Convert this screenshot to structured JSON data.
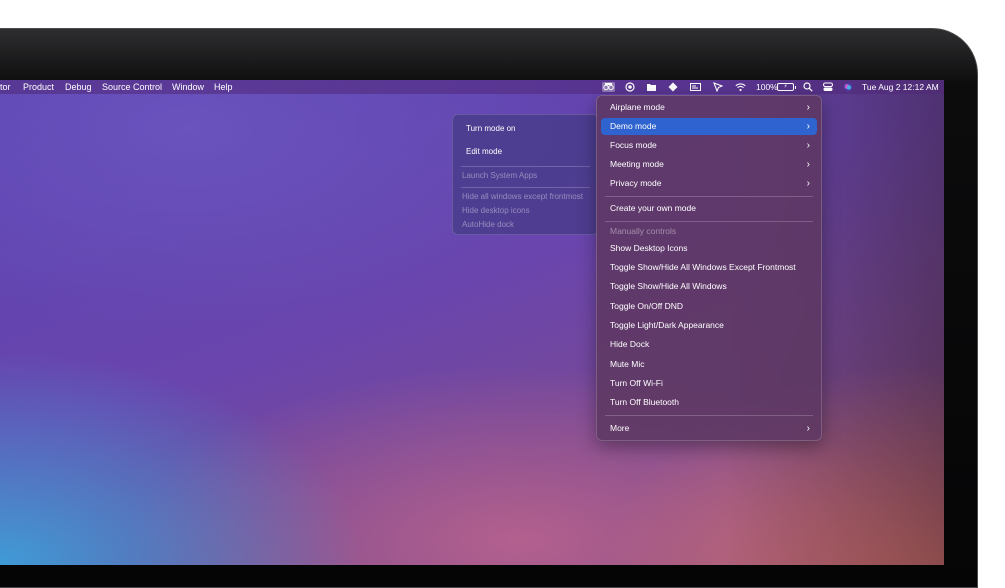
{
  "menubar": {
    "items": [
      "tor",
      "Product",
      "Debug",
      "Source Control",
      "Window",
      "Help"
    ],
    "battery_percent": "100%",
    "battery_icon_text": "⚡",
    "clock": "Tue Aug 2  12:12 AM",
    "status_icons": [
      "app-menu-icon",
      "focus-icon",
      "folder-icon",
      "diamond-icon",
      "card-icon",
      "cursor-icon",
      "wifi-icon",
      "battery-icon",
      "spotlight-icon",
      "control-center-icon",
      "siri-icon"
    ]
  },
  "main_menu": {
    "items": [
      {
        "label": "Airplane mode",
        "submenu": true
      },
      {
        "label": "Demo mode",
        "submenu": true,
        "selected": true
      },
      {
        "label": "Focus mode",
        "submenu": true
      },
      {
        "label": "Meeting mode",
        "submenu": true
      },
      {
        "label": "Privacy mode",
        "submenu": true
      },
      {
        "label": "Create your own mode"
      },
      {
        "label": "Manually controls",
        "disabled": true
      },
      {
        "label": "Show Desktop Icons"
      },
      {
        "label": "Toggle Show/Hide All Windows Except Frontmost"
      },
      {
        "label": "Toggle Show/Hide All Windows"
      },
      {
        "label": "Toggle On/Off DND"
      },
      {
        "label": "Toggle Light/Dark Appearance"
      },
      {
        "label": "Hide Dock"
      },
      {
        "label": "Mute Mic"
      },
      {
        "label": "Turn Off Wi-Fi"
      },
      {
        "label": "Turn Off Bluetooth"
      },
      {
        "label": "More",
        "submenu": true
      }
    ],
    "chevron": "›"
  },
  "sub_menu": {
    "items": [
      {
        "label": "Turn mode on"
      },
      {
        "label": "Edit mode"
      },
      {
        "label": "Launch System Apps",
        "disabled": true
      },
      {
        "label": "Hide all windows except frontmost",
        "disabled": true
      },
      {
        "label": "Hide desktop icons",
        "disabled": true
      },
      {
        "label": "AutoHide dock",
        "disabled": true
      }
    ]
  },
  "colors": {
    "selection": "#2f63cf",
    "menu_bg": "#5d3862",
    "bezel": "#050506"
  }
}
